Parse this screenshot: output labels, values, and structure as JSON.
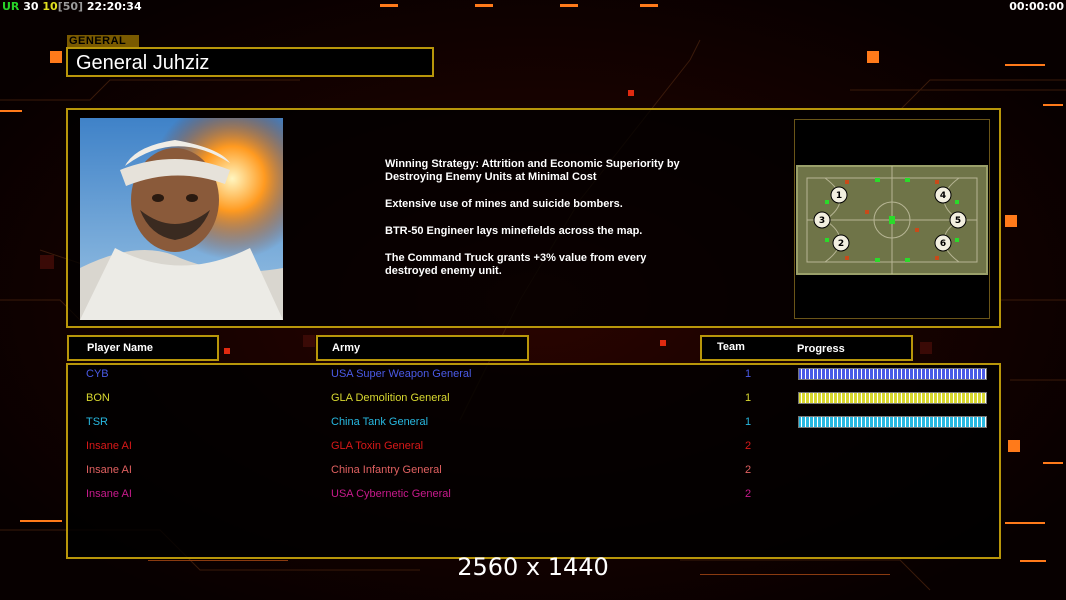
{
  "hud": {
    "left_parts": [
      {
        "text": "UR",
        "color": "#28d428"
      },
      {
        "text": " 30",
        "color": "#ffffff"
      },
      {
        "text": " 10",
        "color": "#e0e020"
      },
      {
        "text": "[50]",
        "color": "#9a9a9a"
      },
      {
        "text": " 22:20:34",
        "color": "#ffffff"
      }
    ],
    "right_clock": "00:00:00"
  },
  "general": {
    "tag": "GENERAL",
    "name": "General Juhziz"
  },
  "strategy": [
    "Winning Strategy: Attrition and Economic Superiority by\n Destroying Enemy Units at Minimal Cost",
    "Extensive use of mines and suicide bombers.",
    "BTR-50 Engineer lays minefields across the map.",
    "The Command Truck grants +3% value from every\n destroyed enemy unit."
  ],
  "minimap": {
    "start_positions": [
      "1",
      "2",
      "3",
      "4",
      "5",
      "6"
    ]
  },
  "columns": {
    "player": "Player Name",
    "army": "Army",
    "team": "Team",
    "progress": "Progress"
  },
  "players": [
    {
      "name": "CYB",
      "army": "USA Super Weapon General",
      "team": "1",
      "color": "#4a5ae6",
      "progress": 1.0
    },
    {
      "name": "BON",
      "army": "GLA Demolition General",
      "team": "1",
      "color": "#d8d830",
      "progress": 1.0
    },
    {
      "name": "TSR",
      "army": "China Tank General",
      "team": "1",
      "color": "#28b8e0",
      "progress": 1.0
    },
    {
      "name": "Insane AI",
      "army": "GLA Toxin General",
      "team": "2",
      "color": "#d81818",
      "progress": 0
    },
    {
      "name": "Insane AI",
      "army": "China Infantry General",
      "team": "2",
      "color": "#e06060",
      "progress": 0
    },
    {
      "name": "Insane AI",
      "army": "USA Cybernetic General",
      "team": "2",
      "color": "#c81a8c",
      "progress": 0
    }
  ],
  "resolution_label": "2560 x 1440"
}
